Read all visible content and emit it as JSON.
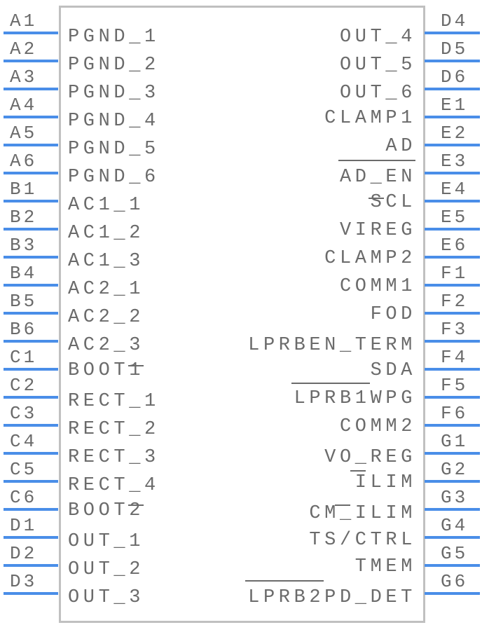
{
  "component": {
    "type": "IC schematic symbol",
    "colors": {
      "pin_line": "#4a8ee8",
      "body_border": "#c0c0c0",
      "text": "#6b6b6b",
      "background": "#ffffff"
    },
    "left_pins": [
      {
        "number": "A1",
        "name": "PGND_1"
      },
      {
        "number": "A2",
        "name": "PGND_2"
      },
      {
        "number": "A3",
        "name": "PGND_3"
      },
      {
        "number": "A4",
        "name": "PGND_4"
      },
      {
        "number": "A5",
        "name": "PGND_5"
      },
      {
        "number": "A6",
        "name": "PGND_6"
      },
      {
        "number": "B1",
        "name": "AC1_1"
      },
      {
        "number": "B2",
        "name": "AC1_2"
      },
      {
        "number": "B3",
        "name": "AC1_3"
      },
      {
        "number": "B4",
        "name": "AC2_1"
      },
      {
        "number": "B5",
        "name": "AC2_2"
      },
      {
        "number": "B6",
        "name": "AC2_3"
      },
      {
        "number": "C1",
        "name": "BOOT1"
      },
      {
        "number": "C2",
        "name": "RECT_1"
      },
      {
        "number": "C3",
        "name": "RECT_2"
      },
      {
        "number": "C4",
        "name": "RECT_3"
      },
      {
        "number": "C5",
        "name": "RECT_4"
      },
      {
        "number": "C6",
        "name": "BOOT2"
      },
      {
        "number": "D1",
        "name": "OUT_1"
      },
      {
        "number": "D2",
        "name": "OUT_2"
      },
      {
        "number": "D3",
        "name": "OUT_3"
      }
    ],
    "right_pins": [
      {
        "number": "D4",
        "name": "OUT_4"
      },
      {
        "number": "D5",
        "name": "OUT_5"
      },
      {
        "number": "D6",
        "name": "OUT_6"
      },
      {
        "number": "E1",
        "name": "CLAMP1"
      },
      {
        "number": "E2",
        "name": "AD"
      },
      {
        "number": "E3",
        "name": "AD_EN"
      },
      {
        "number": "E4",
        "name": "SCL"
      },
      {
        "number": "E5",
        "name": "VIREG"
      },
      {
        "number": "E6",
        "name": "CLAMP2"
      },
      {
        "number": "F1",
        "name": "COMM1"
      },
      {
        "number": "F2",
        "name": "FOD"
      },
      {
        "number": "F3",
        "name": "LPRBEN_TERM"
      },
      {
        "number": "F4",
        "name": "SDA"
      },
      {
        "number": "F5",
        "name": "LPRB1WPG"
      },
      {
        "number": "F6",
        "name": "COMM2"
      },
      {
        "number": "G1",
        "name": "VO_REG"
      },
      {
        "number": "G2",
        "name": "ILIM"
      },
      {
        "number": "G3",
        "name": "CM_ILIM"
      },
      {
        "number": "G4",
        "name": "TS/CTRL"
      },
      {
        "number": "G5",
        "name": "TMEM"
      },
      {
        "number": "G6",
        "name": "LPRB2PD_DET"
      }
    ]
  }
}
